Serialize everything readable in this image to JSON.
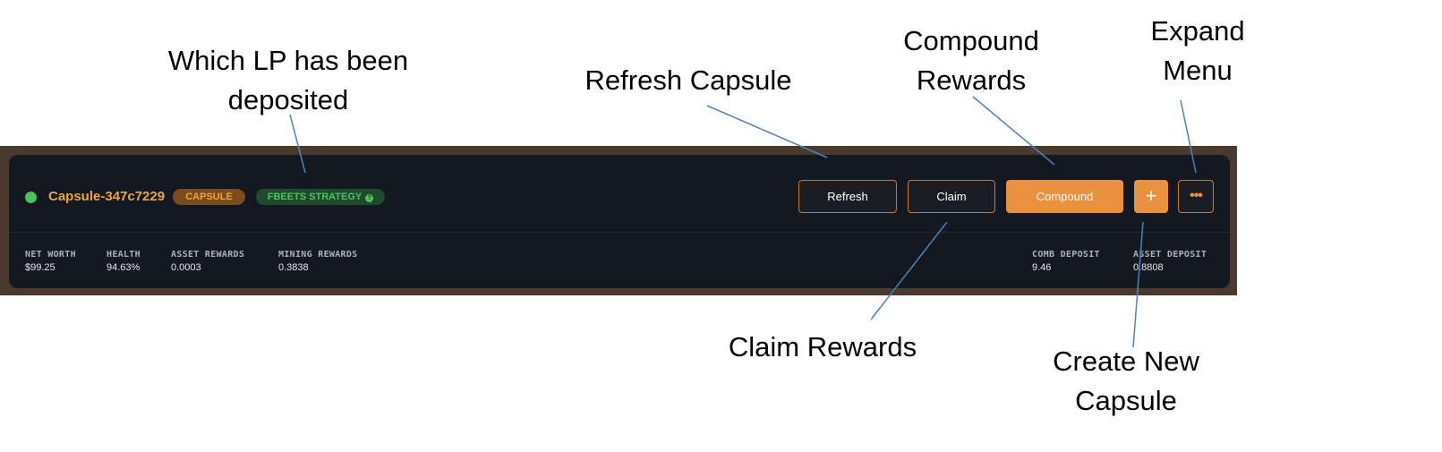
{
  "capsule": {
    "name": "Capsule-347c7229",
    "status_color": "#46c45a",
    "type_tag": "CAPSULE",
    "strategy_tag": "FBEETS STRATEGY",
    "strategy_info_icon": "?"
  },
  "buttons": {
    "refresh": "Refresh",
    "claim": "Claim",
    "compound": "Compound",
    "plus": "+",
    "menu": "•••"
  },
  "stats": [
    {
      "label": "NET WORTH",
      "value": "$99.25"
    },
    {
      "label": "HEALTH",
      "value": "94.63%"
    },
    {
      "label": "ASSET REWARDS",
      "value": "0.0003"
    },
    {
      "label": "MINING REWARDS",
      "value": "0.3838"
    },
    {
      "label": "COMB DEPOSIT",
      "value": "9.46"
    },
    {
      "label": "ASSET DEPOSIT",
      "value": "0.8808"
    }
  ],
  "annotations": {
    "lp": [
      "Which LP has been",
      "deposited"
    ],
    "refresh": "Refresh Capsule",
    "compound": [
      "Compound",
      "Rewards"
    ],
    "expand": [
      "Expand",
      "Menu"
    ],
    "claim": "Claim Rewards",
    "create": [
      "Create New",
      "Capsule"
    ]
  },
  "colors": {
    "accent": "#e8913e",
    "card_bg": "#141821",
    "strategy_green": "#4fc068",
    "annotation_line": "#4f81bd"
  }
}
